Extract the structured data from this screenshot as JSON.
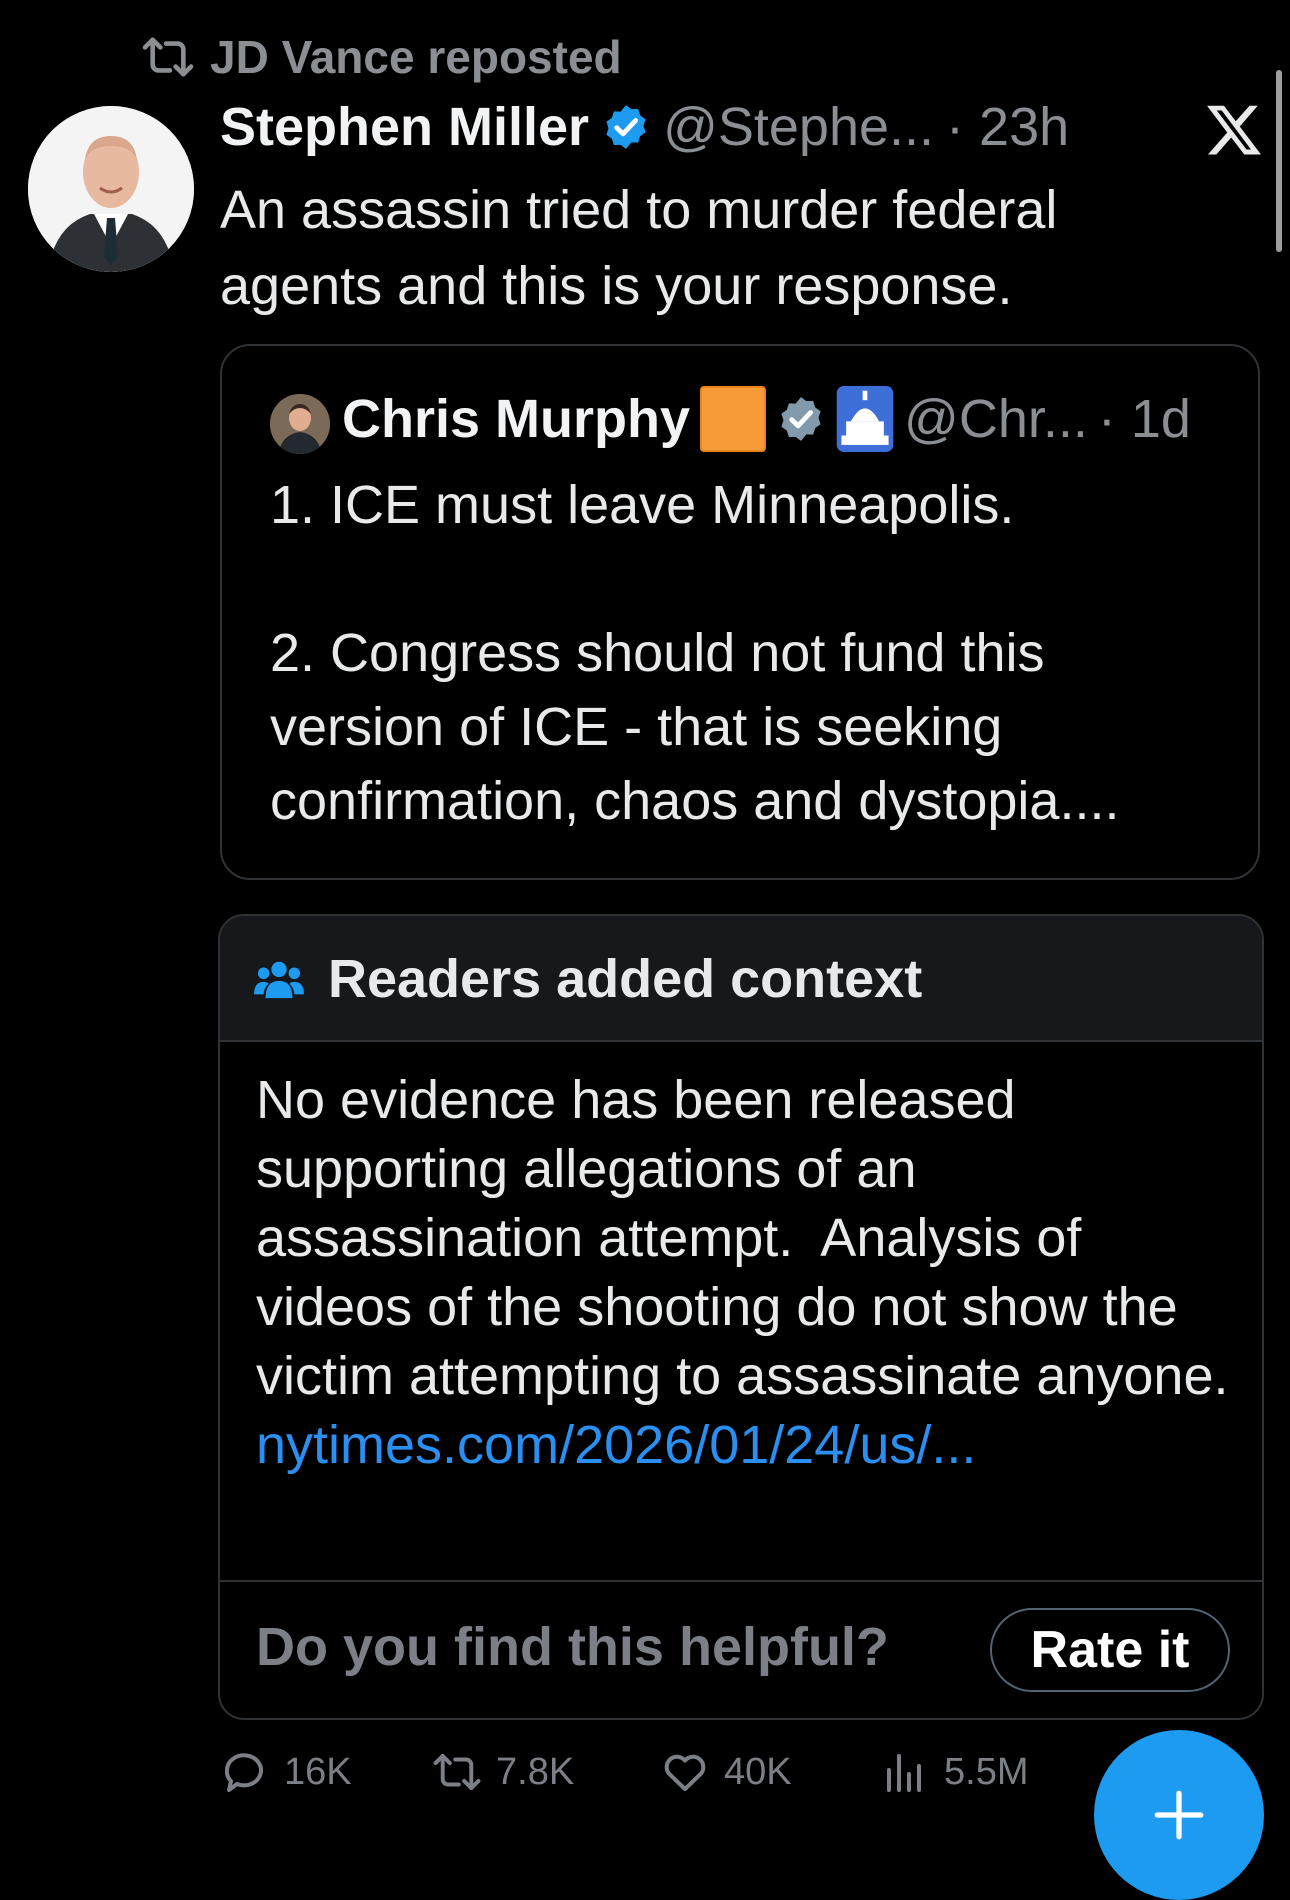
{
  "repost": {
    "text": "JD Vance reposted"
  },
  "post": {
    "author_name": "Stephen Miller",
    "handle": "@Stephe...",
    "time": "· 23h",
    "text": "An assassin tried to murder federal agents and this is your response."
  },
  "quote": {
    "author_name": "Chris Murphy",
    "handle": "@Chr...",
    "time": "· 1d",
    "text": "1. ICE must leave Minneapolis.\n\n2. Congress should not fund this version of ICE - that is seeking confirmation, chaos and dystopia...."
  },
  "note": {
    "title": "Readers added context",
    "text": "No evidence has been released supporting allegations of an assassination attempt.  Analysis of videos of the shooting do not show the victim attempting to assassinate anyone. ",
    "link": "nytimes.com/2026/01/24/us/...",
    "helpful_prompt": "Do you find this helpful?",
    "rate_label": "Rate it"
  },
  "actions": {
    "replies": "16K",
    "reposts": "7.8K",
    "likes": "40K",
    "views": "5.5M"
  },
  "colors": {
    "background": "#000000",
    "accent": "#1d9bf0",
    "link": "#2a8ff0",
    "muted": "#8b8f94",
    "orange": "#f79b39"
  },
  "icons": [
    "repost-icon",
    "verified-badge-icon",
    "x-logo-icon",
    "people-icon",
    "reply-icon",
    "heart-icon",
    "views-icon",
    "plus-icon",
    "capitol-emoji-icon"
  ]
}
